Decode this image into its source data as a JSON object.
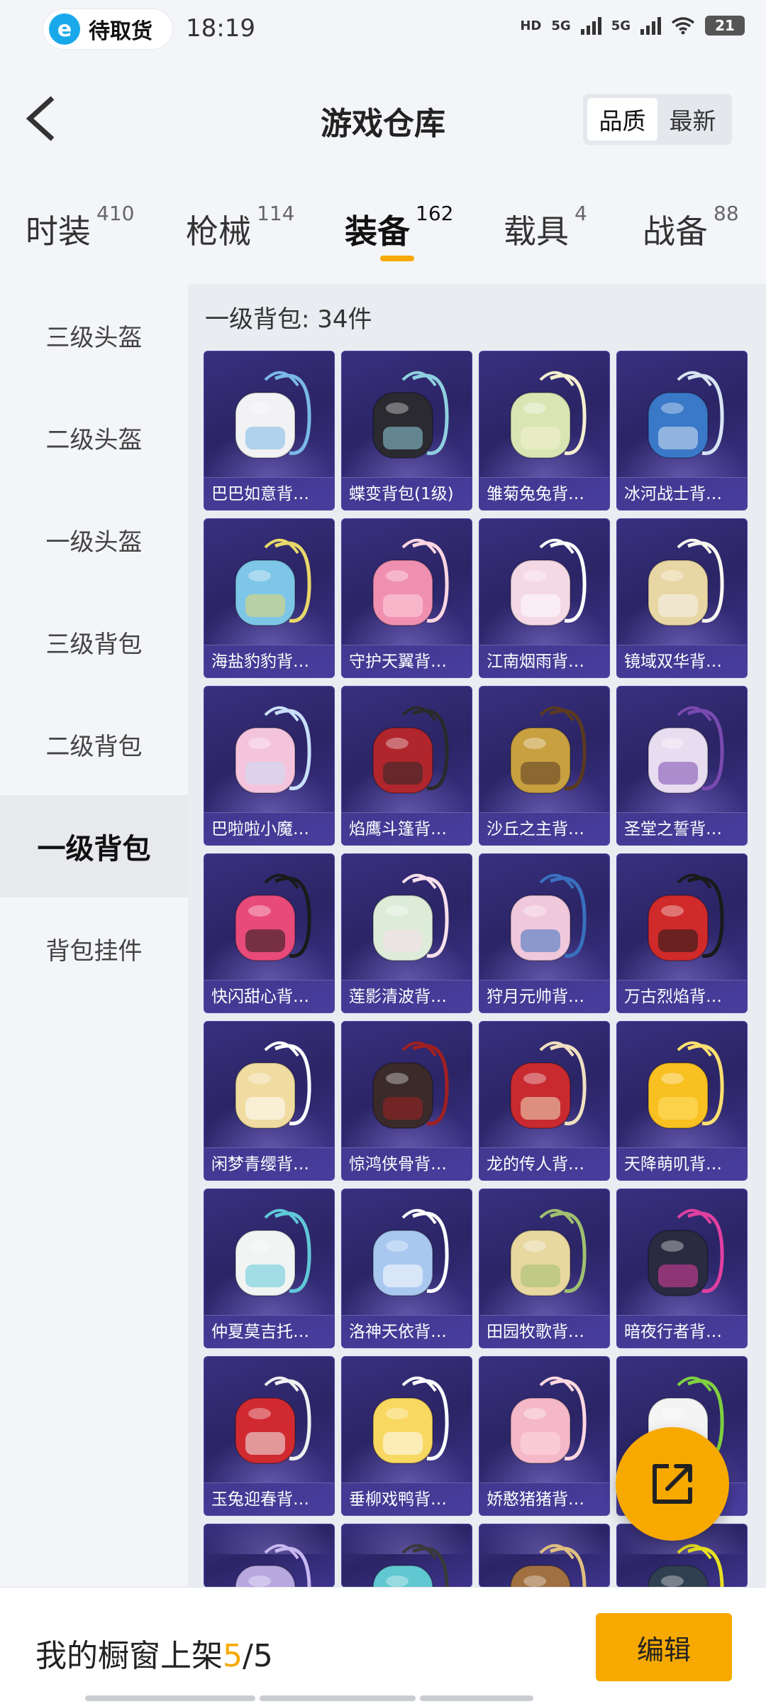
{
  "status_bar": {
    "app_pill_label": "待取货",
    "app_pill_icon": "e-logo-icon",
    "time": "18:19",
    "hd_label": "HD",
    "net1": "5G",
    "net2": "5G",
    "battery": "21"
  },
  "header": {
    "title": "游戏仓库",
    "sort_options": [
      "品质",
      "最新"
    ],
    "sort_selected": "品质"
  },
  "categories": [
    {
      "label": "时装",
      "count": "410"
    },
    {
      "label": "枪械",
      "count": "114"
    },
    {
      "label": "装备",
      "count": "162",
      "active": true
    },
    {
      "label": "载具",
      "count": "4"
    },
    {
      "label": "战备",
      "count": "88"
    }
  ],
  "sidebar": {
    "items": [
      "三级头盔",
      "二级头盔",
      "一级头盔",
      "三级背包",
      "二级背包",
      "一级背包",
      "背包挂件"
    ],
    "active_index": 5
  },
  "content": {
    "section_title": "一级背包: 34件",
    "items": [
      {
        "name": "巴巴如意背…",
        "color": "#f2f2f4",
        "accent": "#7ab8e8"
      },
      {
        "name": "蝶变背包(1级)",
        "color": "#2a2a30",
        "accent": "#8fd0e0"
      },
      {
        "name": "雏菊兔兔背…",
        "color": "#d9e6b4",
        "accent": "#f4f0d0"
      },
      {
        "name": "冰河战士背…",
        "color": "#3a78c8",
        "accent": "#d8e4f4"
      },
      {
        "name": "海盐豹豹背…",
        "color": "#7ec6e8",
        "accent": "#e8d86a"
      },
      {
        "name": "守护天翼背…",
        "color": "#f090b0",
        "accent": "#ffd6e2"
      },
      {
        "name": "江南烟雨背…",
        "color": "#f4d8e4",
        "accent": "#ffffff"
      },
      {
        "name": "镜域双华背…",
        "color": "#e8d6a4",
        "accent": "#f8f6f0"
      },
      {
        "name": "巴啦啦小魔…",
        "color": "#f4c4dc",
        "accent": "#c8e0f8"
      },
      {
        "name": "焰鹰斗篷背…",
        "color": "#b0262c",
        "accent": "#2a2a2a"
      },
      {
        "name": "沙丘之主背…",
        "color": "#c8a040",
        "accent": "#5a3a20"
      },
      {
        "name": "圣堂之誓背…",
        "color": "#e8dcf0",
        "accent": "#7a4ab0"
      },
      {
        "name": "快闪甜心背…",
        "color": "#e84a7a",
        "accent": "#1a1a1a"
      },
      {
        "name": "莲影清波背…",
        "color": "#dcecd8",
        "accent": "#f8e0ec"
      },
      {
        "name": "狩月元帅背…",
        "color": "#f0c8dc",
        "accent": "#3a70c0"
      },
      {
        "name": "万古烈焰背…",
        "color": "#d02a2a",
        "accent": "#1a1a1a"
      },
      {
        "name": "闲梦青缨背…",
        "color": "#f0dca0",
        "accent": "#ffffff"
      },
      {
        "name": "惊鸿侠骨背…",
        "color": "#3a2a2a",
        "accent": "#a02020"
      },
      {
        "name": "龙的传人背…",
        "color": "#c82a30",
        "accent": "#f0e0c0"
      },
      {
        "name": "天降萌叽背…",
        "color": "#f8c020",
        "accent": "#ffe070"
      },
      {
        "name": "仲夏莫吉托…",
        "color": "#f2f4f4",
        "accent": "#60c8d8"
      },
      {
        "name": "洛神天依背…",
        "color": "#a8c8f0",
        "accent": "#ffffff"
      },
      {
        "name": "田园牧歌背…",
        "color": "#e8d8a0",
        "accent": "#a0c070"
      },
      {
        "name": "暗夜行者背…",
        "color": "#2a2a40",
        "accent": "#e040a0"
      },
      {
        "name": "玉兔迎春背…",
        "color": "#d02a30",
        "accent": "#f0f0f0"
      },
      {
        "name": "垂柳戏鸭背…",
        "color": "#f8d860",
        "accent": "#ffffff"
      },
      {
        "name": "娇憨猪猪背…",
        "color": "#f4b8c8",
        "accent": "#ffd8e0"
      },
      {
        "name": "",
        "color": "#f4f4f4",
        "accent": "#80d040"
      },
      {
        "name": "",
        "color": "#b8a8e0",
        "accent": "#c8b8f0"
      },
      {
        "name": "",
        "color": "#60c8d0",
        "accent": "#3a3a3a"
      },
      {
        "name": "",
        "color": "#a07040",
        "accent": "#e0c080"
      },
      {
        "name": "",
        "color": "#304050",
        "accent": "#e8e020"
      }
    ]
  },
  "fab_icon": "share-external-icon",
  "bottom": {
    "showcase_label": "我的橱窗上架",
    "showcase_count": "5",
    "showcase_total": "/5",
    "edit_label": "编辑"
  }
}
